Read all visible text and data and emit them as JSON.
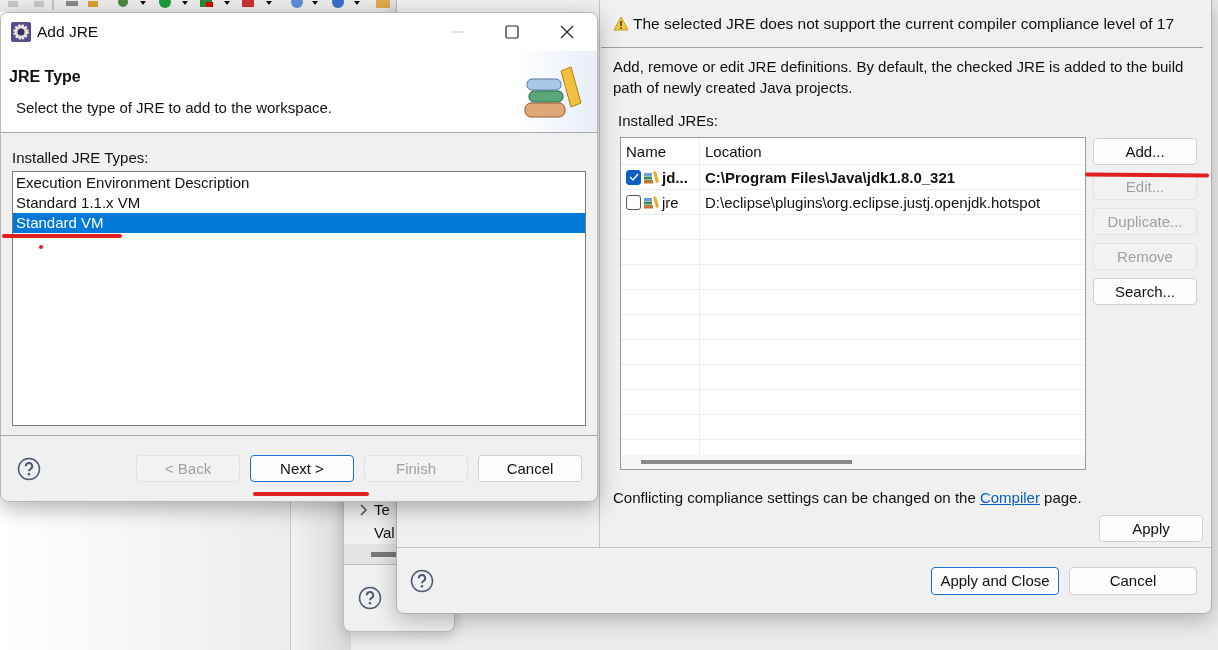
{
  "background_window": {
    "items": [
      {
        "label": "Te",
        "expandable": true
      },
      {
        "label": "Val",
        "expandable": false
      }
    ]
  },
  "preferences": {
    "warning": "The selected JRE does not support the current compiler compliance level of 17",
    "description": "Add, remove or edit JRE definitions. By default, the checked JRE is added to the build path of newly created Java projects.",
    "installed_label": "Installed JREs:",
    "table": {
      "columns": [
        "Name",
        "Location"
      ],
      "rows": [
        {
          "name": "jd...",
          "location": "C:\\Program Files\\Java\\jdk1.8.0_321",
          "checked": true
        },
        {
          "name": "jre",
          "location": "D:\\eclipse\\plugins\\org.eclipse.justj.openjdk.hotspot",
          "checked": false
        }
      ]
    },
    "side_buttons": [
      {
        "label": "Add...",
        "disabled": false
      },
      {
        "label": "Edit...",
        "disabled": true
      },
      {
        "label": "Duplicate...",
        "disabled": true
      },
      {
        "label": "Remove",
        "disabled": true
      },
      {
        "label": "Search...",
        "disabled": false
      }
    ],
    "compliance_note": {
      "before": "Conflicting compliance settings can be changed on the",
      "link": "Compiler",
      "after": "page."
    },
    "apply": "Apply",
    "footer_buttons": [
      {
        "label": "Apply and Close",
        "disabled": false,
        "default": true
      },
      {
        "label": "Cancel",
        "disabled": false,
        "default": false
      }
    ]
  },
  "add_jre": {
    "title": "Add JRE",
    "header_title": "JRE Type",
    "header_description": "Select the type of JRE to add to the workspace.",
    "list_label": "Installed JRE Types:",
    "types": [
      {
        "label": "Execution Environment Description",
        "selected": false
      },
      {
        "label": "Standard 1.1.x VM",
        "selected": false
      },
      {
        "label": "Standard VM",
        "selected": true
      }
    ],
    "buttons": [
      {
        "label": "< Back",
        "disabled": true,
        "default": false
      },
      {
        "label": "Next >",
        "disabled": false,
        "default": true
      },
      {
        "label": "Finish",
        "disabled": true,
        "default": false
      },
      {
        "label": "Cancel",
        "disabled": false,
        "default": false
      }
    ]
  }
}
